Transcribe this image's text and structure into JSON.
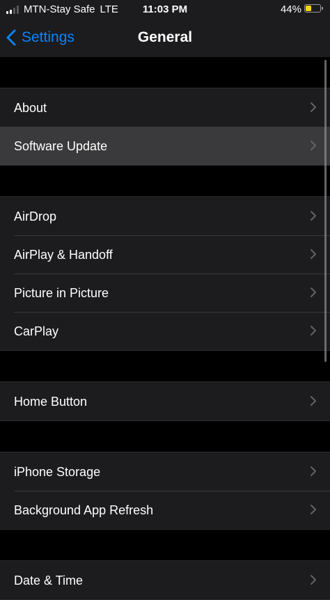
{
  "status_bar": {
    "carrier": "MTN-Stay Safe",
    "network": "LTE",
    "time": "11:03 PM",
    "battery_percent_label": "44%",
    "battery_level": 0.44,
    "signal_bars": 2,
    "signal_icon": "cellular-signal-icon",
    "battery_icon": "battery-icon"
  },
  "nav": {
    "back_label": "Settings",
    "back_icon": "chevron-left-icon",
    "title": "General"
  },
  "groups": [
    {
      "items": [
        {
          "label": "About"
        },
        {
          "label": "Software Update"
        }
      ]
    },
    {
      "items": [
        {
          "label": "AirDrop"
        },
        {
          "label": "AirPlay & Handoff"
        },
        {
          "label": "Picture in Picture"
        },
        {
          "label": "CarPlay"
        }
      ]
    },
    {
      "items": [
        {
          "label": "Home Button"
        }
      ]
    },
    {
      "items": [
        {
          "label": "iPhone Storage"
        },
        {
          "label": "Background App Refresh"
        }
      ]
    },
    {
      "items": [
        {
          "label": "Date & Time"
        }
      ]
    }
  ],
  "highlighted_item": "Software Update",
  "colors": {
    "background": "#000000",
    "cell": "#1c1c1e",
    "cell_highlighted": "#3a3a3c",
    "accent": "#0a84ff",
    "battery": "#ffd60a",
    "chevron": "#636366"
  }
}
